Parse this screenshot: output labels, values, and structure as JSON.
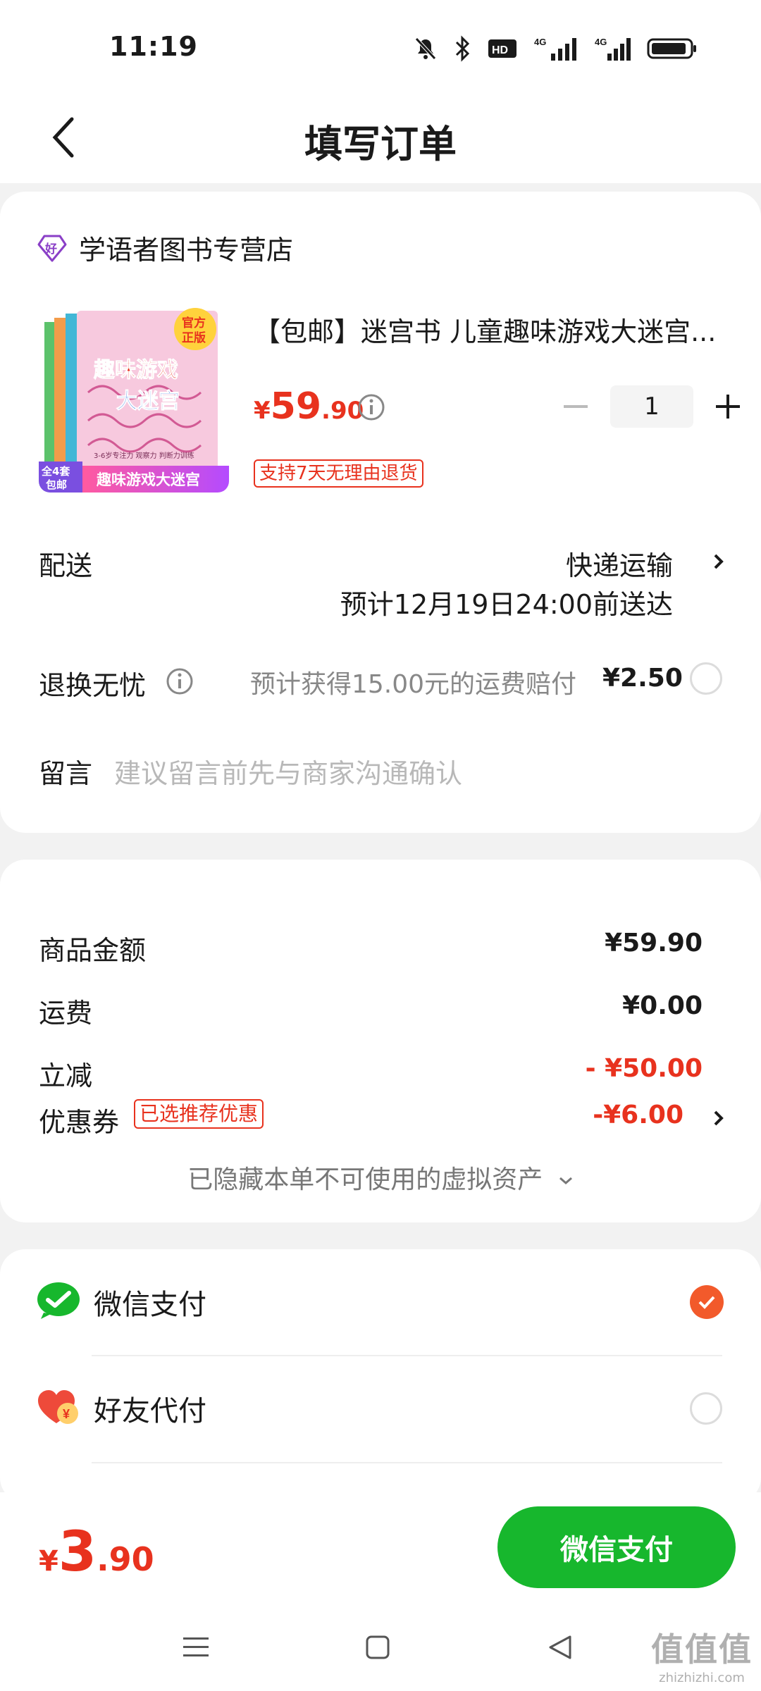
{
  "status_bar": {
    "time": "11:19",
    "icons": [
      "mute-bell-icon",
      "bluetooth-icon",
      "hd-icon",
      "signal-4g-icon",
      "signal-4g-icon",
      "battery-icon"
    ]
  },
  "header": {
    "title": "填写订单",
    "back_icon": "chevron-left-icon"
  },
  "store": {
    "badge_icon": "good-store-diamond-icon",
    "name": "学语者图书专营店"
  },
  "product": {
    "title": "【包邮】迷宫书 儿童趣味游戏大迷宫...",
    "price_symbol": "¥",
    "price_int": "59",
    "price_dec": ".90",
    "quantity": "1",
    "return_policy": "支持7天无理由退货",
    "cover": {
      "badge_top": "官方",
      "badge_bottom": "正版",
      "book_title_1": "趣味游戏",
      "book_title_2": "大迷宫",
      "tag_line": "3-6岁专注力 观察力 判断力训练",
      "corner_1": "全4套",
      "corner_2": "包邮",
      "banner": "趣味游戏大迷宫"
    }
  },
  "delivery": {
    "label": "配送",
    "method": "快递运输",
    "eta": "预计12月19日24:00前送达"
  },
  "return_insurance": {
    "label": "退换无忧",
    "description": "预计获得15.00元的运费赔付",
    "price": "¥2.50"
  },
  "message": {
    "label": "留言",
    "placeholder": "建议留言前先与商家沟通确认"
  },
  "summary": {
    "goods_label": "商品金额",
    "goods_value": "¥59.90",
    "shipping_label": "运费",
    "shipping_value": "¥0.00",
    "discount_label": "立减",
    "discount_value": "- ¥50.00",
    "coupon_label": "优惠券",
    "coupon_badge": "已选推荐优惠",
    "coupon_value": "-¥6.00",
    "hidden_assets": "已隐藏本单不可使用的虚拟资产"
  },
  "payment": {
    "options": [
      {
        "label": "微信支付",
        "icon": "wechat-pay-icon",
        "selected": true
      },
      {
        "label": "好友代付",
        "icon": "friend-pay-heart-icon",
        "selected": false
      }
    ]
  },
  "bottom": {
    "total_symbol": "¥",
    "total_int": "3",
    "total_dec": ".90",
    "pay_button": "微信支付"
  },
  "watermark": {
    "main": "值值值",
    "sub": "zhizhizhi.com"
  },
  "colors": {
    "accent_red": "#e8321e",
    "wechat_green": "#17b72d",
    "check_orange": "#f25a2b"
  }
}
